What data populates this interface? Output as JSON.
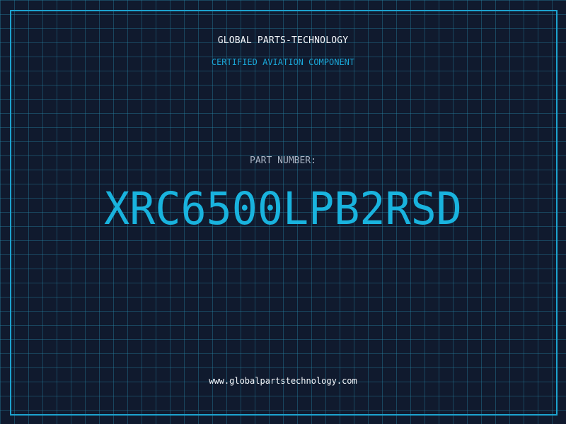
{
  "header": {
    "company": "GLOBAL PARTS-TECHNOLOGY",
    "subtitle": "CERTIFIED AVIATION COMPONENT"
  },
  "part": {
    "label": "PART NUMBER:",
    "number": "XRC6500LPB2RSD"
  },
  "footer": {
    "url": "www.globalpartstechnology.com"
  },
  "colors": {
    "background": "#101a2e",
    "grid": "#288caa",
    "accent": "#19b3de",
    "text": "#f4f7fb",
    "muted": "#a9b4c4"
  }
}
